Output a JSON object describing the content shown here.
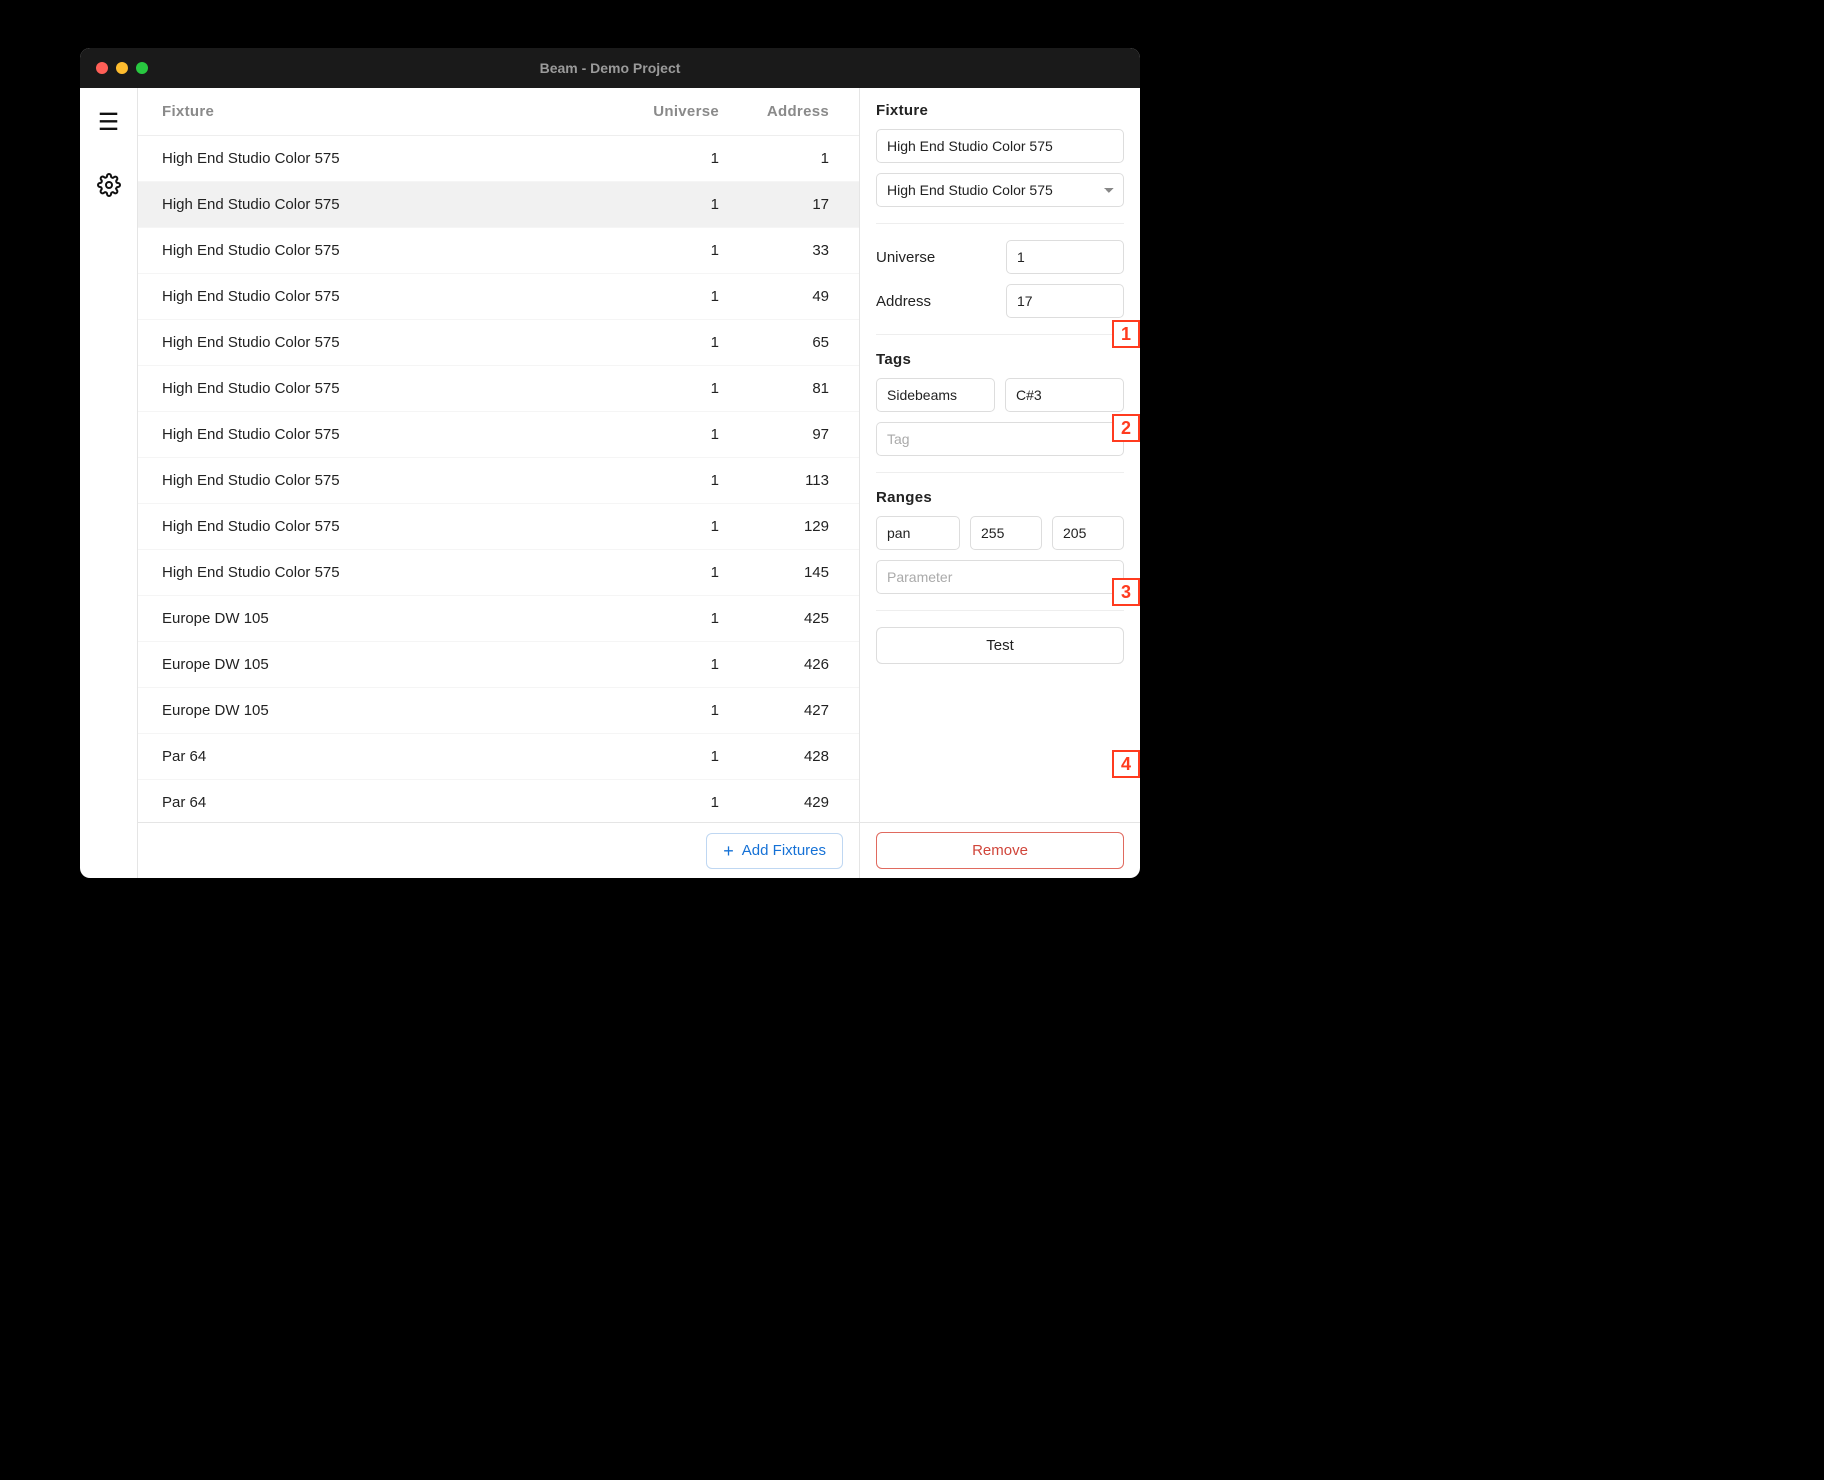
{
  "window": {
    "title": "Beam - Demo Project"
  },
  "table": {
    "headers": {
      "fixture": "Fixture",
      "universe": "Universe",
      "address": "Address"
    },
    "rows": [
      {
        "fixture": "High End Studio Color 575",
        "universe": 1,
        "address": 1
      },
      {
        "fixture": "High End Studio Color 575",
        "universe": 1,
        "address": 17
      },
      {
        "fixture": "High End Studio Color 575",
        "universe": 1,
        "address": 33
      },
      {
        "fixture": "High End Studio Color 575",
        "universe": 1,
        "address": 49
      },
      {
        "fixture": "High End Studio Color 575",
        "universe": 1,
        "address": 65
      },
      {
        "fixture": "High End Studio Color 575",
        "universe": 1,
        "address": 81
      },
      {
        "fixture": "High End Studio Color 575",
        "universe": 1,
        "address": 97
      },
      {
        "fixture": "High End Studio Color 575",
        "universe": 1,
        "address": 113
      },
      {
        "fixture": "High End Studio Color 575",
        "universe": 1,
        "address": 129
      },
      {
        "fixture": "High End Studio Color 575",
        "universe": 1,
        "address": 145
      },
      {
        "fixture": "Europe DW 105",
        "universe": 1,
        "address": 425
      },
      {
        "fixture": "Europe DW 105",
        "universe": 1,
        "address": 426
      },
      {
        "fixture": "Europe DW 105",
        "universe": 1,
        "address": 427
      },
      {
        "fixture": "Par 64",
        "universe": 1,
        "address": 428
      },
      {
        "fixture": "Par 64",
        "universe": 1,
        "address": 429
      }
    ],
    "selected_index": 1
  },
  "buttons": {
    "add_fixtures": "Add Fixtures",
    "test": "Test",
    "remove": "Remove"
  },
  "inspector": {
    "fixture_label": "Fixture",
    "name_value": "High End Studio Color 575",
    "profile_value": "High End Studio Color 575",
    "universe_label": "Universe",
    "universe_value": "1",
    "address_label": "Address",
    "address_value": "17",
    "tags_label": "Tags",
    "tags": [
      "Sidebeams",
      "C#3"
    ],
    "tag_placeholder": "Tag",
    "ranges_label": "Ranges",
    "range": {
      "param": "pan",
      "a": "255",
      "b": "205"
    },
    "range_placeholder": "Parameter"
  },
  "annotations": [
    "1",
    "2",
    "3",
    "4"
  ]
}
